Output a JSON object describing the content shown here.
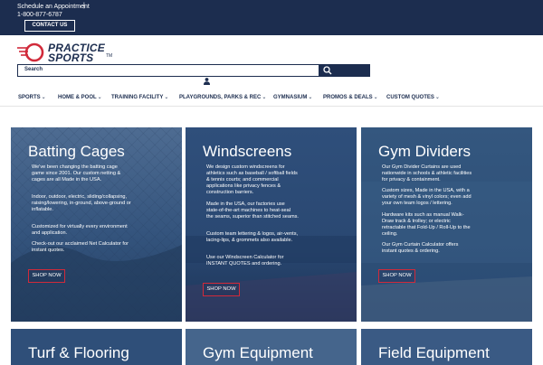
{
  "topbar": {
    "appointment": "Schedule an Appointment",
    "separator": "|",
    "phone": "1-800-877-6787",
    "contact_label": "CONTACT US"
  },
  "logo": {
    "line1": "PRACTICE",
    "line2": "SPORTS",
    "tm": "TM"
  },
  "search": {
    "label": "Search"
  },
  "icons": {
    "search": "search-icon",
    "user": "user-icon",
    "logo": "practice-sports-logo-icon"
  },
  "colors": {
    "navy": "#1c2d4f",
    "accent_red": "#d12a3a",
    "card_blue": "#2d4d78"
  },
  "nav": {
    "items": [
      {
        "label": "SPORTS",
        "chevron": "⌄"
      },
      {
        "label": "HOME & POOL",
        "chevron": "⌄"
      },
      {
        "label": "TRAINING FACILITY",
        "chevron": "⌄"
      },
      {
        "label": "PLAYGROUNDS, PARKS & REC",
        "chevron": "⌄"
      },
      {
        "label": "GYMNASIUM",
        "chevron": "⌄"
      },
      {
        "label": "PROMOS & DEALS",
        "chevron": "⌄"
      },
      {
        "label": "CUSTOM QUOTES",
        "chevron": "⌄"
      }
    ]
  },
  "cards": [
    {
      "title": "Batting Cages",
      "paragraphs": [
        "We've been changing the batting cage game since 2001. Our custom netting & cages are all Made in the USA.",
        "Indoor, outdoor, electric, sliding/collapsing, raising/lowering, in-ground, above-ground or inflatable.",
        "Customized for virtually every environment and application.",
        "Check-out our acclaimed Net Calculator for instant quotes."
      ],
      "button": "SHOP NOW"
    },
    {
      "title": "Windscreens",
      "paragraphs": [
        "We design custom windscreens for athletics such as baseball / softball fields & tennis courts; and commercial applications like privacy fences & construction barriers.",
        "Made in the USA, our factories use state-of-the-art machines to heat-seal the seams, superior than stitched seams.",
        "Custom team lettering & logos, air-vents, lacing-lips, & grommets also available.",
        "Use our Windscreen Calculator for INSTANT QUOTES and ordering."
      ],
      "button": "SHOP NOW"
    },
    {
      "title": "Gym Dividers",
      "paragraphs": [
        "Our Gym Divider Curtains are used nationwide in schools & athletic facilities for privacy & containment.",
        "Custom sizes, Made in the USA, with a variety of mesh & vinyl colors; even add your own team logos / lettering.",
        "Hardware kits such as manual Walk-Draw track & trolley; or electric retractable that Fold-Up / Roll-Up to the ceiling.",
        "Our Gym Curtain Calculator offers instant quotes & ordering."
      ],
      "button": "SHOP NOW"
    }
  ],
  "bottom_cards": [
    {
      "title": "Turf & Flooring"
    },
    {
      "title": "Gym Equipment"
    },
    {
      "title": "Field Equipment"
    }
  ]
}
